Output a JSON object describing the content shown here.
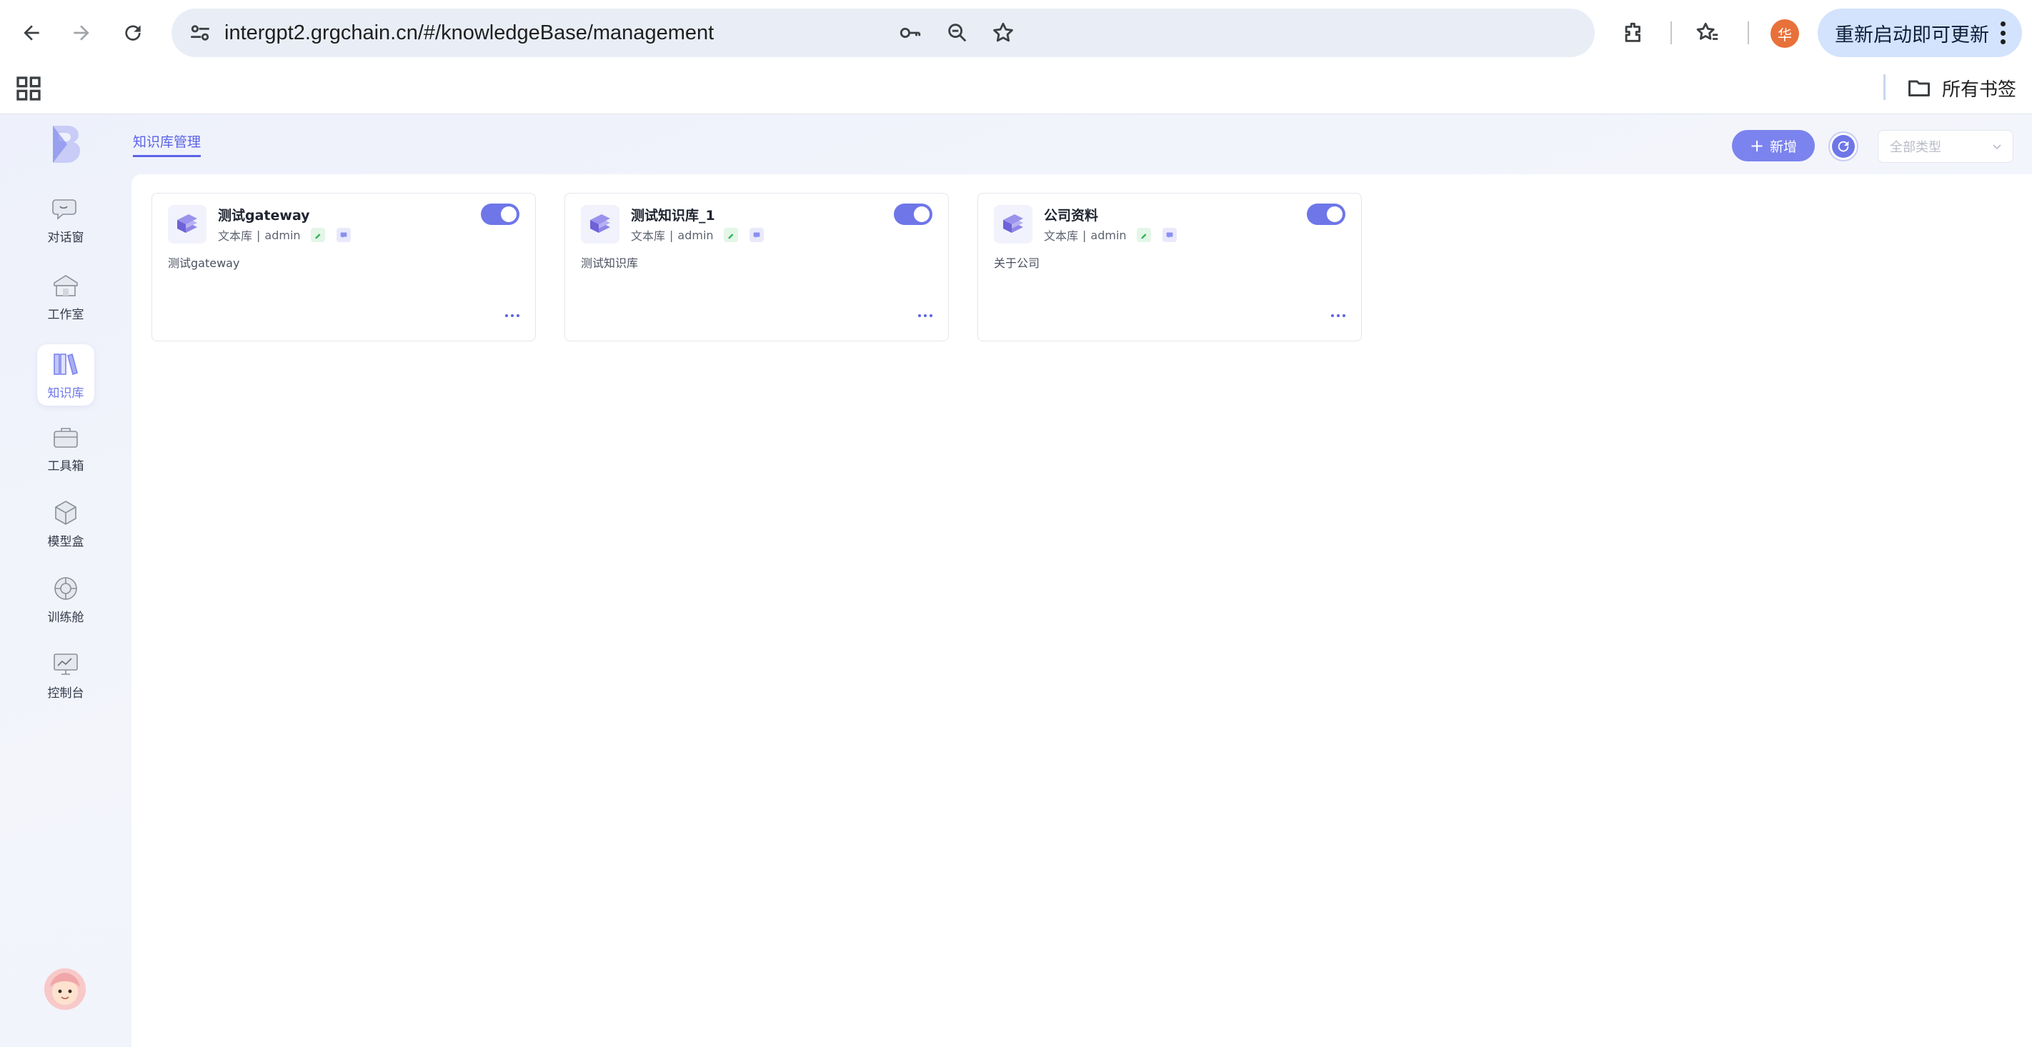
{
  "browser": {
    "url": "intergpt2.grgchain.cn/#/knowledgeBase/management",
    "profile_initial": "华",
    "update_label": "重新启动即可更新",
    "bookmarks_all": "所有书签"
  },
  "sidebar": {
    "items": [
      {
        "label": "对话窗",
        "icon": "chat-icon"
      },
      {
        "label": "工作室",
        "icon": "studio-icon"
      },
      {
        "label": "知识库",
        "icon": "books-icon"
      },
      {
        "label": "工具箱",
        "icon": "toolbox-icon"
      },
      {
        "label": "模型盒",
        "icon": "model-box-icon"
      },
      {
        "label": "训练舱",
        "icon": "training-icon"
      },
      {
        "label": "控制台",
        "icon": "console-icon"
      }
    ],
    "active": "知识库"
  },
  "header": {
    "tab_label": "知识库管理",
    "add_label": "新增",
    "type_placeholder": "全部类型"
  },
  "cards": [
    {
      "title": "测试gateway",
      "type": "文本库",
      "owner": "admin",
      "description": "测试gateway",
      "enabled": true
    },
    {
      "title": "测试知识库_1",
      "type": "文本库",
      "owner": "admin",
      "description": "测试知识库",
      "enabled": true
    },
    {
      "title": "公司资料",
      "type": "文本库",
      "owner": "admin",
      "description": "关于公司",
      "enabled": true
    }
  ],
  "colors": {
    "accent": "#6e76e8",
    "tab_text": "#5b63e6",
    "update_bg": "#d3e3fd",
    "profile": "#e8713a"
  }
}
